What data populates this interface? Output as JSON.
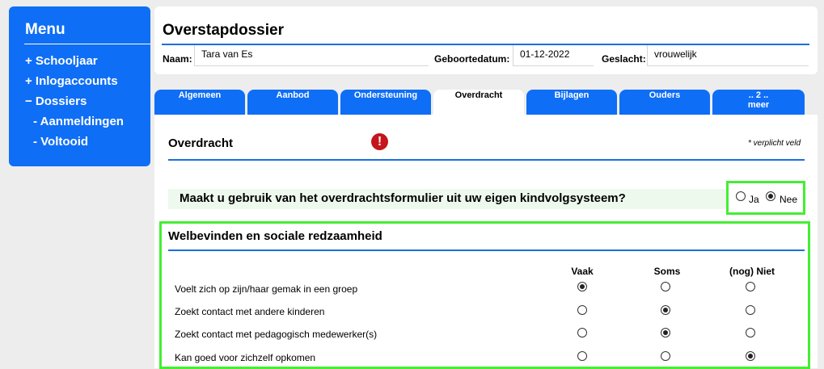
{
  "menu": {
    "title": "Menu",
    "items": [
      {
        "label": "+ Schooljaar"
      },
      {
        "label": "+ Inlogaccounts"
      },
      {
        "label": "− Dossiers"
      },
      {
        "label": "- Aanmeldingen"
      },
      {
        "label": "- Voltooid"
      }
    ]
  },
  "header": {
    "title": "Overstapdossier",
    "name_label": "Naam:",
    "name_value": "Tara van Es",
    "dob_label": "Geboortedatum:",
    "dob_value": "01-12-2022",
    "gender_label": "Geslacht:",
    "gender_value": "vrouwelijk"
  },
  "tabs": [
    {
      "label": "Algemeen"
    },
    {
      "label": "Aanbod"
    },
    {
      "label": "Ondersteuning"
    },
    {
      "label": "Overdracht"
    },
    {
      "label": "Bijlagen"
    },
    {
      "label": "Ouders"
    },
    {
      "label": ".. 2 .."
    },
    {
      "label": "meer"
    }
  ],
  "section": {
    "title": "Overdracht",
    "required_note": "* verplicht veld",
    "warning_glyph": "!"
  },
  "question": {
    "text": "Maakt u gebruik van het overdrachtsformulier uit uw eigen kindvolgsysteem?",
    "options": [
      "Ja",
      "Nee"
    ],
    "selected": "Nee"
  },
  "wellbeing": {
    "title": "Welbevinden en sociale redzaamheid",
    "columns": [
      "Vaak",
      "Soms",
      "(nog) Niet"
    ],
    "rows": [
      {
        "label": "Voelt zich op zijn/haar gemak in een groep",
        "selected": "Vaak"
      },
      {
        "label": "Zoekt contact met andere kinderen",
        "selected": "Soms"
      },
      {
        "label": "Zoekt contact met pedagogisch medewerker(s)",
        "selected": "Soms"
      },
      {
        "label": "Kan goed voor zichzelf opkomen",
        "selected": "(nog) Niet"
      }
    ]
  },
  "colors": {
    "accent": "#0f6ef6",
    "highlight": "#44ee33",
    "warning": "#c4161c"
  }
}
